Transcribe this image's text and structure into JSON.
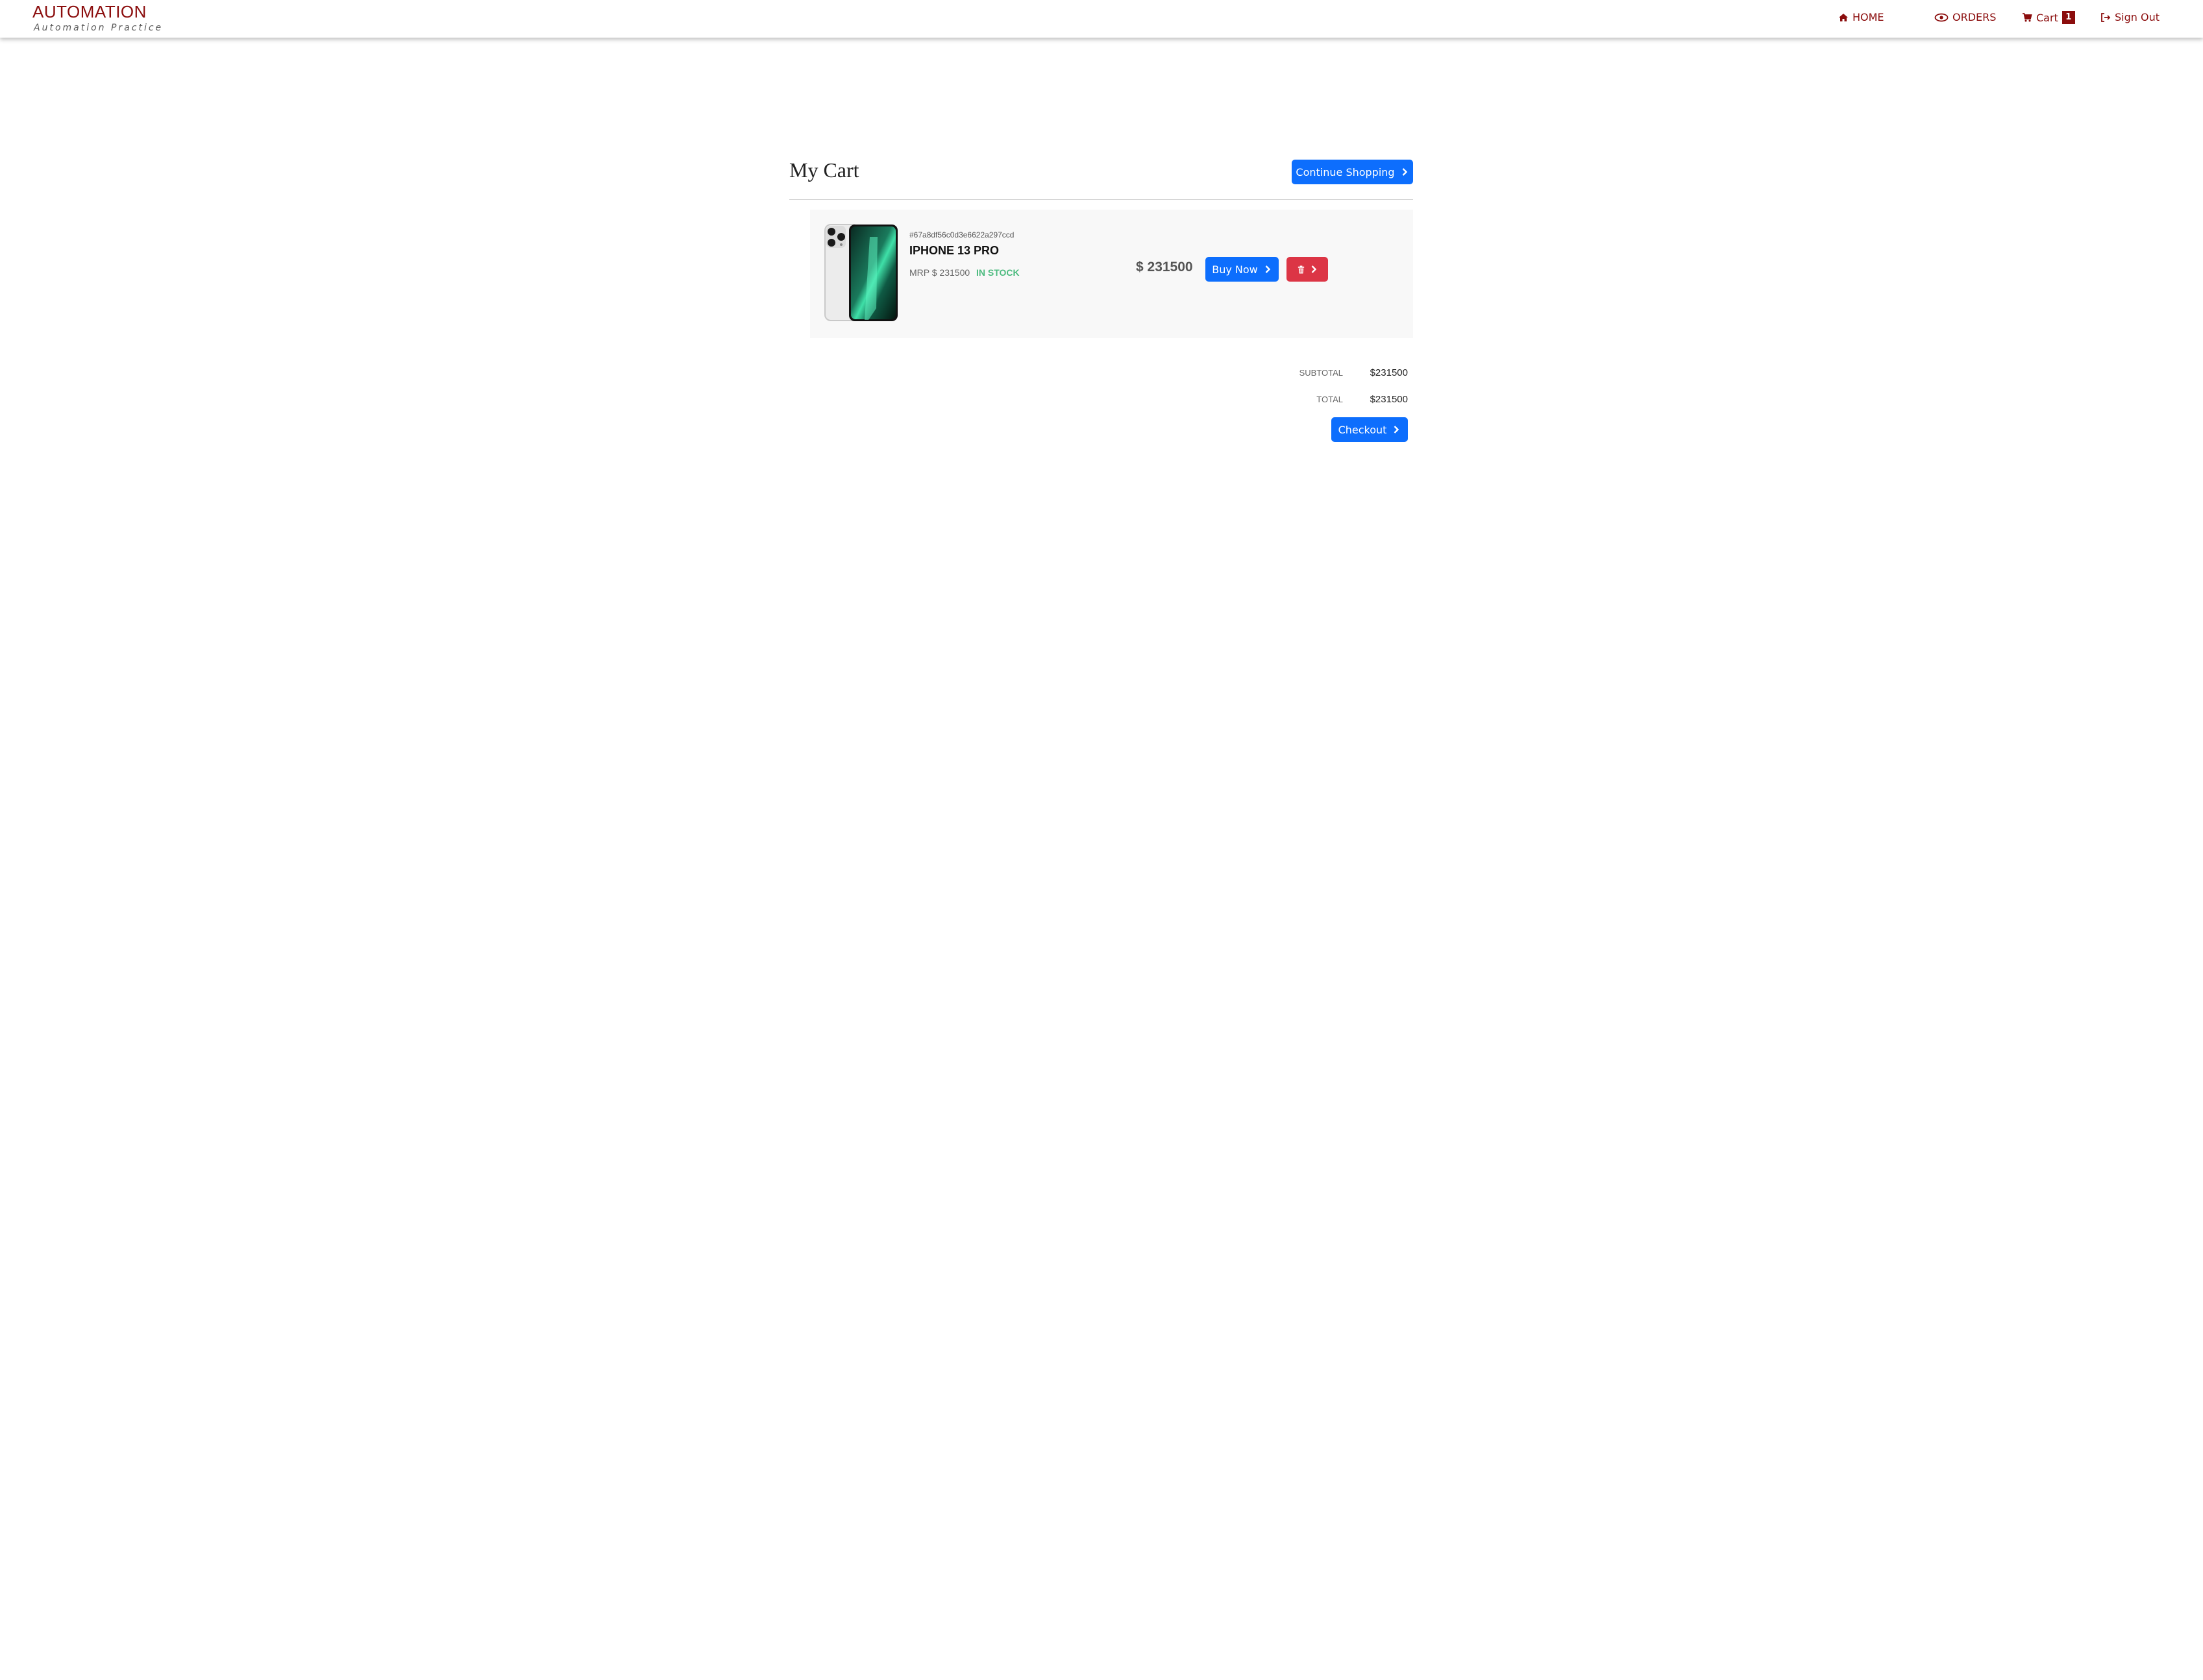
{
  "header": {
    "brand_title": "AUTOMATION",
    "brand_subtitle": "Automation Practice",
    "nav": {
      "home": "HOME",
      "orders": "ORDERS",
      "cart": "Cart",
      "cart_count": "1",
      "sign_out": "Sign Out"
    }
  },
  "main": {
    "title": "My Cart",
    "continue_label": "Continue Shopping"
  },
  "cart_items": [
    {
      "id": "#67a8df56c0d3e6622a297ccd",
      "name": "IPHONE 13 PRO",
      "mrp": "MRP $ 231500",
      "stock": "IN STOCK",
      "price": "$ 231500",
      "buy_label": "Buy Now",
      "delete_icon": "trash-icon"
    }
  ],
  "summary": {
    "subtotal_label": "Subtotal",
    "subtotal_value": "$231500",
    "total_label": "Total",
    "total_value": "$231500",
    "checkout_label": "Checkout"
  },
  "colors": {
    "brand": "#8b0d0d",
    "primary": "#0d6efd",
    "danger": "#dc3545",
    "in_stock": "#4cbb7f"
  }
}
